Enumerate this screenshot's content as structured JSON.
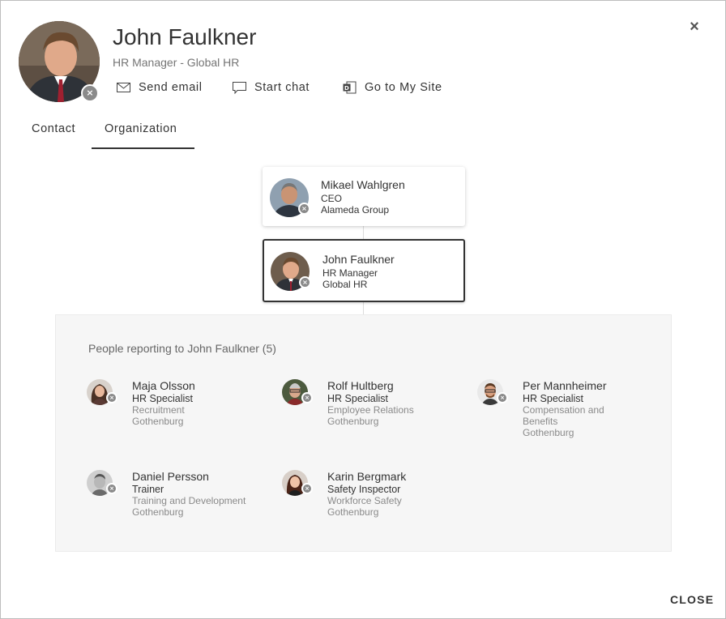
{
  "header": {
    "name": "John Faulkner",
    "title": "HR Manager - Global HR",
    "actions": [
      {
        "label": "Send email",
        "icon": "mail-icon"
      },
      {
        "label": "Start chat",
        "icon": "chat-icon"
      },
      {
        "label": "Go to My Site",
        "icon": "sharepoint-icon"
      }
    ],
    "presence_icon": "presence-offline-icon"
  },
  "tabs": [
    {
      "label": "Contact",
      "selected": false
    },
    {
      "label": "Organization",
      "selected": true
    }
  ],
  "org": {
    "manager": {
      "name": "Mikael Wahlgren",
      "title": "CEO",
      "department": "Alameda Group"
    },
    "current": {
      "name": "John Faulkner",
      "title": "HR Manager",
      "department": "Global HR"
    },
    "reports_heading": "People reporting to John Faulkner (5)",
    "reports": [
      {
        "name": "Maja Olsson",
        "title": "HR Specialist",
        "department": "Recruitment",
        "location": "Gothenburg"
      },
      {
        "name": "Rolf Hultberg",
        "title": "HR Specialist",
        "department": "Employee Relations",
        "location": "Gothenburg"
      },
      {
        "name": "Per Mannheimer",
        "title": "HR Specialist",
        "department": "Compensation and Benefits",
        "location": "Gothenburg"
      },
      {
        "name": "Daniel Persson",
        "title": "Trainer",
        "department": "Training and Development",
        "location": "Gothenburg"
      },
      {
        "name": "Karin Bergmark",
        "title": "Safety Inspector",
        "department": "Workforce Safety",
        "location": "Gothenburg"
      }
    ]
  },
  "footer": {
    "close_label": "CLOSE"
  },
  "colors": {
    "presence": "#8a8a8a",
    "tab_underline": "#333333",
    "reports_bg": "#f6f6f6"
  }
}
